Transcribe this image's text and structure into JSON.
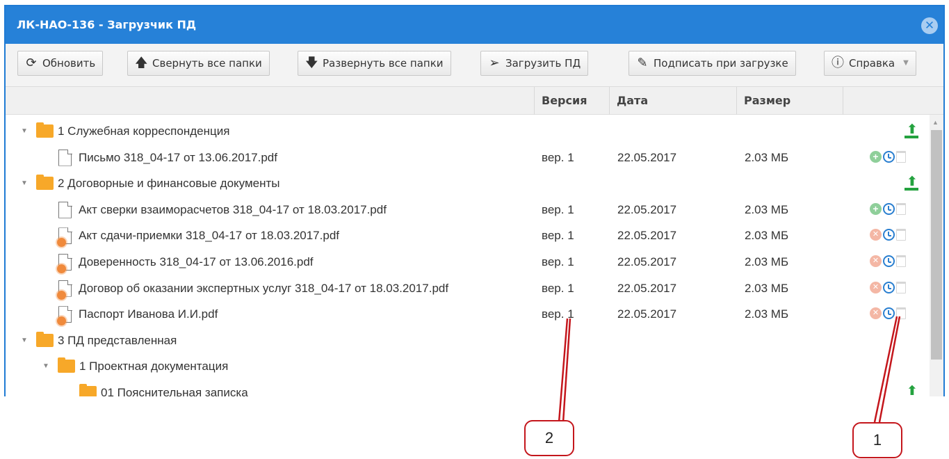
{
  "window": {
    "title": "ЛК-НАО-136 - Загрузчик ПД",
    "close_glyph": "✕"
  },
  "toolbar": {
    "refresh": {
      "label": "Обновить",
      "icon": "refresh-icon"
    },
    "collapse": {
      "label": "Свернуть все папки",
      "icon": "arrow-up-icon"
    },
    "expand": {
      "label": "Развернуть все папки",
      "icon": "arrow-down-icon"
    },
    "upload": {
      "label": "Загрузить ПД",
      "icon": "send-icon"
    },
    "sign": {
      "label": "Подписать при загрузке",
      "icon": "pencil-icon"
    },
    "help": {
      "label": "Справка",
      "icon": "help-icon"
    }
  },
  "columns": {
    "version": "Версия",
    "date": "Дата",
    "size": "Размер"
  },
  "rows": [
    {
      "kind": "folder",
      "level": 0,
      "name": "1 Служебная корреспонденция",
      "upload": true
    },
    {
      "kind": "file",
      "signed": false,
      "name": "Письмо 318_04-17 от 13.06.2017.pdf",
      "version": "вер. 1",
      "date": "22.05.2017",
      "size": "2.03 МБ"
    },
    {
      "kind": "folder",
      "level": 0,
      "name": "2 Договорные и финансовые документы",
      "upload": true
    },
    {
      "kind": "file",
      "signed": false,
      "name": "Акт сверки взаиморасчетов 318_04-17 от 18.03.2017.pdf",
      "version": "вер. 1",
      "date": "22.05.2017",
      "size": "2.03 МБ"
    },
    {
      "kind": "file",
      "signed": true,
      "name": "Акт сдачи-приемки 318_04-17 от 18.03.2017.pdf",
      "version": "вер. 1",
      "date": "22.05.2017",
      "size": "2.03 МБ"
    },
    {
      "kind": "file",
      "signed": true,
      "name": "Доверенность 318_04-17 от 13.06.2016.pdf",
      "version": "вер. 1",
      "date": "22.05.2017",
      "size": "2.03 МБ"
    },
    {
      "kind": "file",
      "signed": true,
      "name": "Договор об оказании экспертных услуг 318_04-17 от 18.03.2017.pdf",
      "version": "вер. 1",
      "date": "22.05.2017",
      "size": "2.03 МБ"
    },
    {
      "kind": "file",
      "signed": true,
      "name": "Паспорт Иванова И.И.pdf",
      "version": "вер. 1",
      "date": "22.05.2017",
      "size": "2.03 МБ"
    },
    {
      "kind": "folder",
      "level": 0,
      "name": "3 ПД представленная",
      "upload": false
    },
    {
      "kind": "folder",
      "level": 1,
      "name": "1 Проектная документация",
      "upload": false
    },
    {
      "kind": "folder",
      "level": 2,
      "name": "01 Пояснительная записка",
      "upload": true
    }
  ],
  "callouts": [
    {
      "label": "2"
    },
    {
      "label": "1"
    }
  ],
  "colors": {
    "titlebar": "#2681d8",
    "folder": "#f7a829",
    "upload": "#24a23f",
    "callout": "#c4161c"
  }
}
